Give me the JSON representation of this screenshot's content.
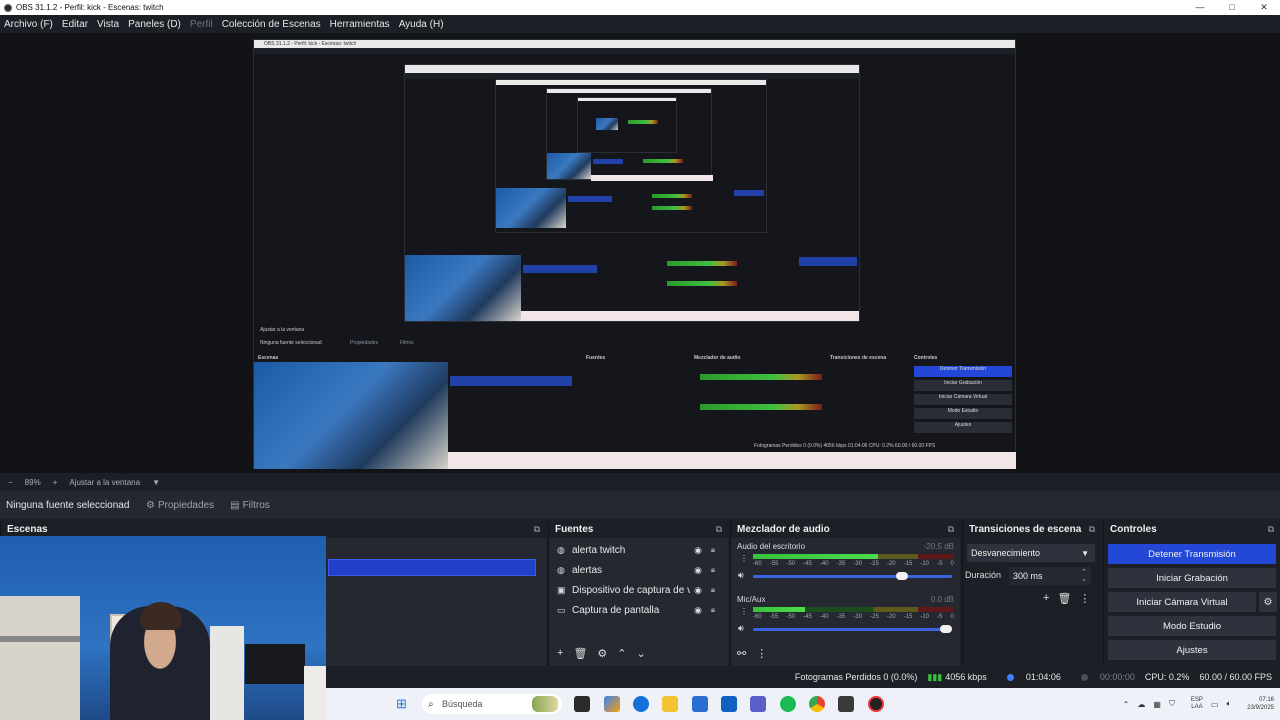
{
  "window": {
    "title": "OBS 31.1.2 - Perfil: kick - Escenas: twitch",
    "controls": [
      "—",
      "□",
      "✕"
    ]
  },
  "menu": {
    "items": [
      "Archivo (F)",
      "Editar",
      "Vista",
      "Paneles (D)",
      "Perfil",
      "Colección de Escenas",
      "Herramientas",
      "Ayuda (H)"
    ]
  },
  "zoom": {
    "minus": "−",
    "value": "89%",
    "plus": "+",
    "fit_label": "Ajustar a la ventana",
    "dropdown": "▼"
  },
  "source_toolbar": {
    "no_source": "Ninguna fuente seleccionad",
    "properties": "Propiedades",
    "filters": "Filtros"
  },
  "scenes": {
    "title": "Escenas"
  },
  "sources": {
    "title": "Fuentes",
    "items": [
      {
        "label": "alerta twitch",
        "icon": "browser-icon"
      },
      {
        "label": "alertas",
        "icon": "browser-icon"
      },
      {
        "label": "Dispositivo de captura de vídeo",
        "icon": "camera-icon"
      },
      {
        "label": "Captura de pantalla",
        "icon": "monitor-icon"
      }
    ]
  },
  "mixer": {
    "title": "Mezclador de audio",
    "ticks": [
      "-60",
      "-55",
      "-50",
      "-45",
      "-40",
      "-35",
      "-30",
      "-25",
      "-20",
      "-15",
      "-10",
      "-5",
      "0"
    ],
    "channels": [
      {
        "name": "Audio del escritorio",
        "db": "-20.5 dB",
        "level": 0.62,
        "volume": 0.78
      },
      {
        "name": "Mic/Aux",
        "db": "0.0 dB",
        "level": 0.26,
        "volume": 1.0
      }
    ]
  },
  "transitions": {
    "title": "Transiciones de escena",
    "selected": "Desvanecimiento",
    "duration_label": "Duración",
    "duration_value": "300 ms"
  },
  "controls": {
    "title": "Controles",
    "stop_stream": "Detener Transmisión",
    "start_recording": "Iniciar Grabación",
    "start_virtual_cam": "Iniciar Cámara Virtual",
    "studio_mode": "Modo Estudio",
    "settings": "Ajustes",
    "accent": "#2348d8"
  },
  "status": {
    "dropped_frames": "Fotogramas Perdidos 0 (0.0%)",
    "bitrate": "4056 kbps",
    "stream_time": "01:04:06",
    "record_time": "00:00:00",
    "cpu": "CPU: 0.2%",
    "fps": "60.00 / 60.00 FPS"
  },
  "taskbar": {
    "search_placeholder": "Búsqueda",
    "lang_top": "ESP",
    "lang_bottom": "LAA",
    "time": "07:16",
    "date": "23/9/2025"
  },
  "nested": {
    "title": "OBS 31.1.2 - Perfil: kick - Escenas: twitch",
    "no_source": "Ninguna fuente seleccionad",
    "properties": "Propiedades",
    "filters": "Filtros",
    "scenes": "Escenas",
    "sources": "Fuentes",
    "mixer": "Mezclador de audio",
    "transitions": "Transiciones de escena",
    "controls": "Controles",
    "stop": "Detener Transmisión",
    "rec": "Iniciar Grabación",
    "vcam": "Iniciar Cámara Virtual",
    "studio": "Modo Estudio",
    "settings": "Ajustes",
    "fit": "Ajustar a la ventana",
    "status": "Fotogramas Perdidos 0 (0.0%)  4056 kbps  01:04:06  CPU: 0.2%  60.00 / 60.00 FPS"
  }
}
